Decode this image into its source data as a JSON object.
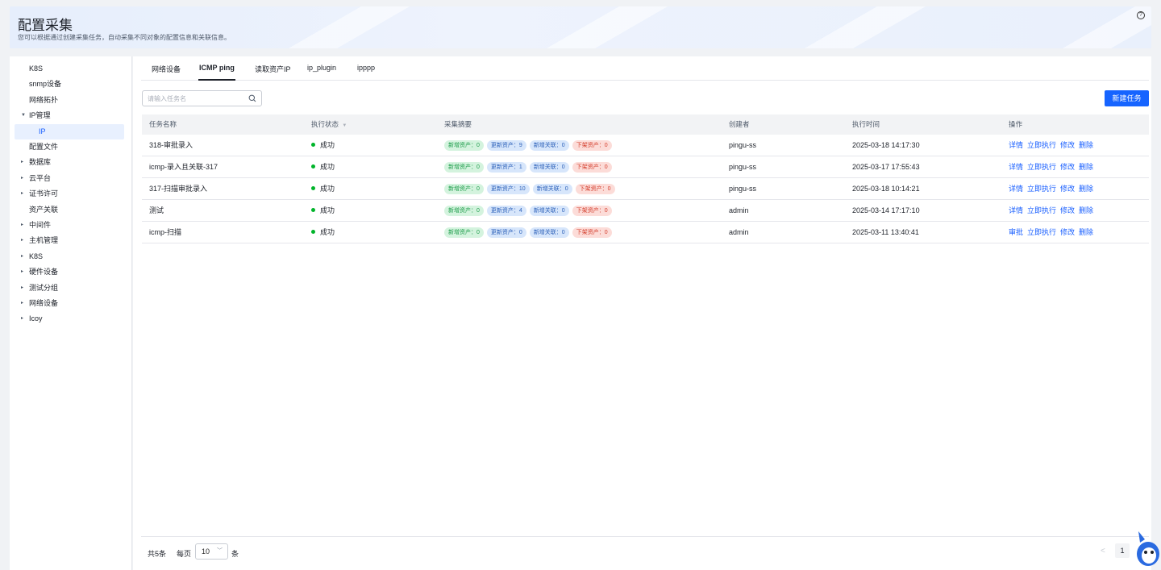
{
  "header": {
    "title": "配置采集",
    "description": "您可以根据通过创建采集任务，自动采集不同对象的配置信息和关联信息。",
    "help_icon": "?"
  },
  "sidebar": {
    "items": [
      {
        "label": "K8S",
        "caret": ""
      },
      {
        "label": "snmp设备",
        "caret": ""
      },
      {
        "label": "网络拓扑",
        "caret": ""
      },
      {
        "label": "IP管理",
        "caret": "▼"
      },
      {
        "label": "IP",
        "caret": ""
      },
      {
        "label": "配置文件",
        "caret": ""
      },
      {
        "label": "数据库",
        "caret": "▸"
      },
      {
        "label": "云平台",
        "caret": "▸"
      },
      {
        "label": "证书许可",
        "caret": "▸"
      },
      {
        "label": "资产关联",
        "caret": ""
      },
      {
        "label": "中间件",
        "caret": "▸"
      },
      {
        "label": "主机管理",
        "caret": "▸"
      },
      {
        "label": "K8S",
        "caret": "▸"
      },
      {
        "label": "硬件设备",
        "caret": "▸"
      },
      {
        "label": "测试分组",
        "caret": "▸"
      },
      {
        "label": "网络设备",
        "caret": "▸"
      },
      {
        "label": "Icoy",
        "caret": "▸"
      }
    ]
  },
  "tabs": [
    {
      "label": "网络设备"
    },
    {
      "label": "ICMP ping"
    },
    {
      "label": "读取资产IP"
    },
    {
      "label": "ip_plugin"
    },
    {
      "label": "ipppp"
    }
  ],
  "search": {
    "placeholder": "请输入任务名"
  },
  "new_button": "新建任务",
  "table": {
    "columns": [
      "任务名称",
      "执行状态",
      "采集摘要",
      "创建者",
      "执行时间",
      "操作"
    ],
    "filter_icon": "▼",
    "rows": [
      {
        "name": "318-审批录入",
        "status": "成功",
        "tags": [
          "新增资产：0",
          "更新资产：9",
          "新增关联：0",
          "下架资产：0"
        ],
        "creator": "pingu-ss",
        "time": "2025-03-18 14:17:30",
        "ops": [
          "详情",
          "立即执行",
          "修改",
          "删除"
        ]
      },
      {
        "name": "icmp-录入且关联-317",
        "status": "成功",
        "tags": [
          "新增资产：0",
          "更新资产：1",
          "新增关联：0",
          "下架资产：0"
        ],
        "creator": "pingu-ss",
        "time": "2025-03-17 17:55:43",
        "ops": [
          "详情",
          "立即执行",
          "修改",
          "删除"
        ]
      },
      {
        "name": "317-扫描审批录入",
        "status": "成功",
        "tags": [
          "新增资产：0",
          "更新资产：10",
          "新增关联：0",
          "下架资产：0"
        ],
        "creator": "pingu-ss",
        "time": "2025-03-18 10:14:21",
        "ops": [
          "详情",
          "立即执行",
          "修改",
          "删除"
        ]
      },
      {
        "name": "测试",
        "status": "成功",
        "tags": [
          "新增资产：0",
          "更新资产：4",
          "新增关联：0",
          "下架资产：0"
        ],
        "creator": "admin",
        "time": "2025-03-14 17:17:10",
        "ops": [
          "详情",
          "立即执行",
          "修改",
          "删除"
        ]
      },
      {
        "name": "icmp-扫描",
        "status": "成功",
        "tags": [
          "新增资产：0",
          "更新资产：0",
          "新增关联：0",
          "下架资产：0"
        ],
        "creator": "admin",
        "time": "2025-03-11 13:40:41",
        "ops": [
          "审批",
          "立即执行",
          "修改",
          "删除"
        ]
      }
    ]
  },
  "pagination": {
    "total": "共5条",
    "per_page_label": "每页",
    "page_size": "10",
    "unit": "条",
    "prev": "<",
    "current_page": "1"
  },
  "colors": {
    "primary": "#1664ff",
    "success": "#00b42a"
  }
}
